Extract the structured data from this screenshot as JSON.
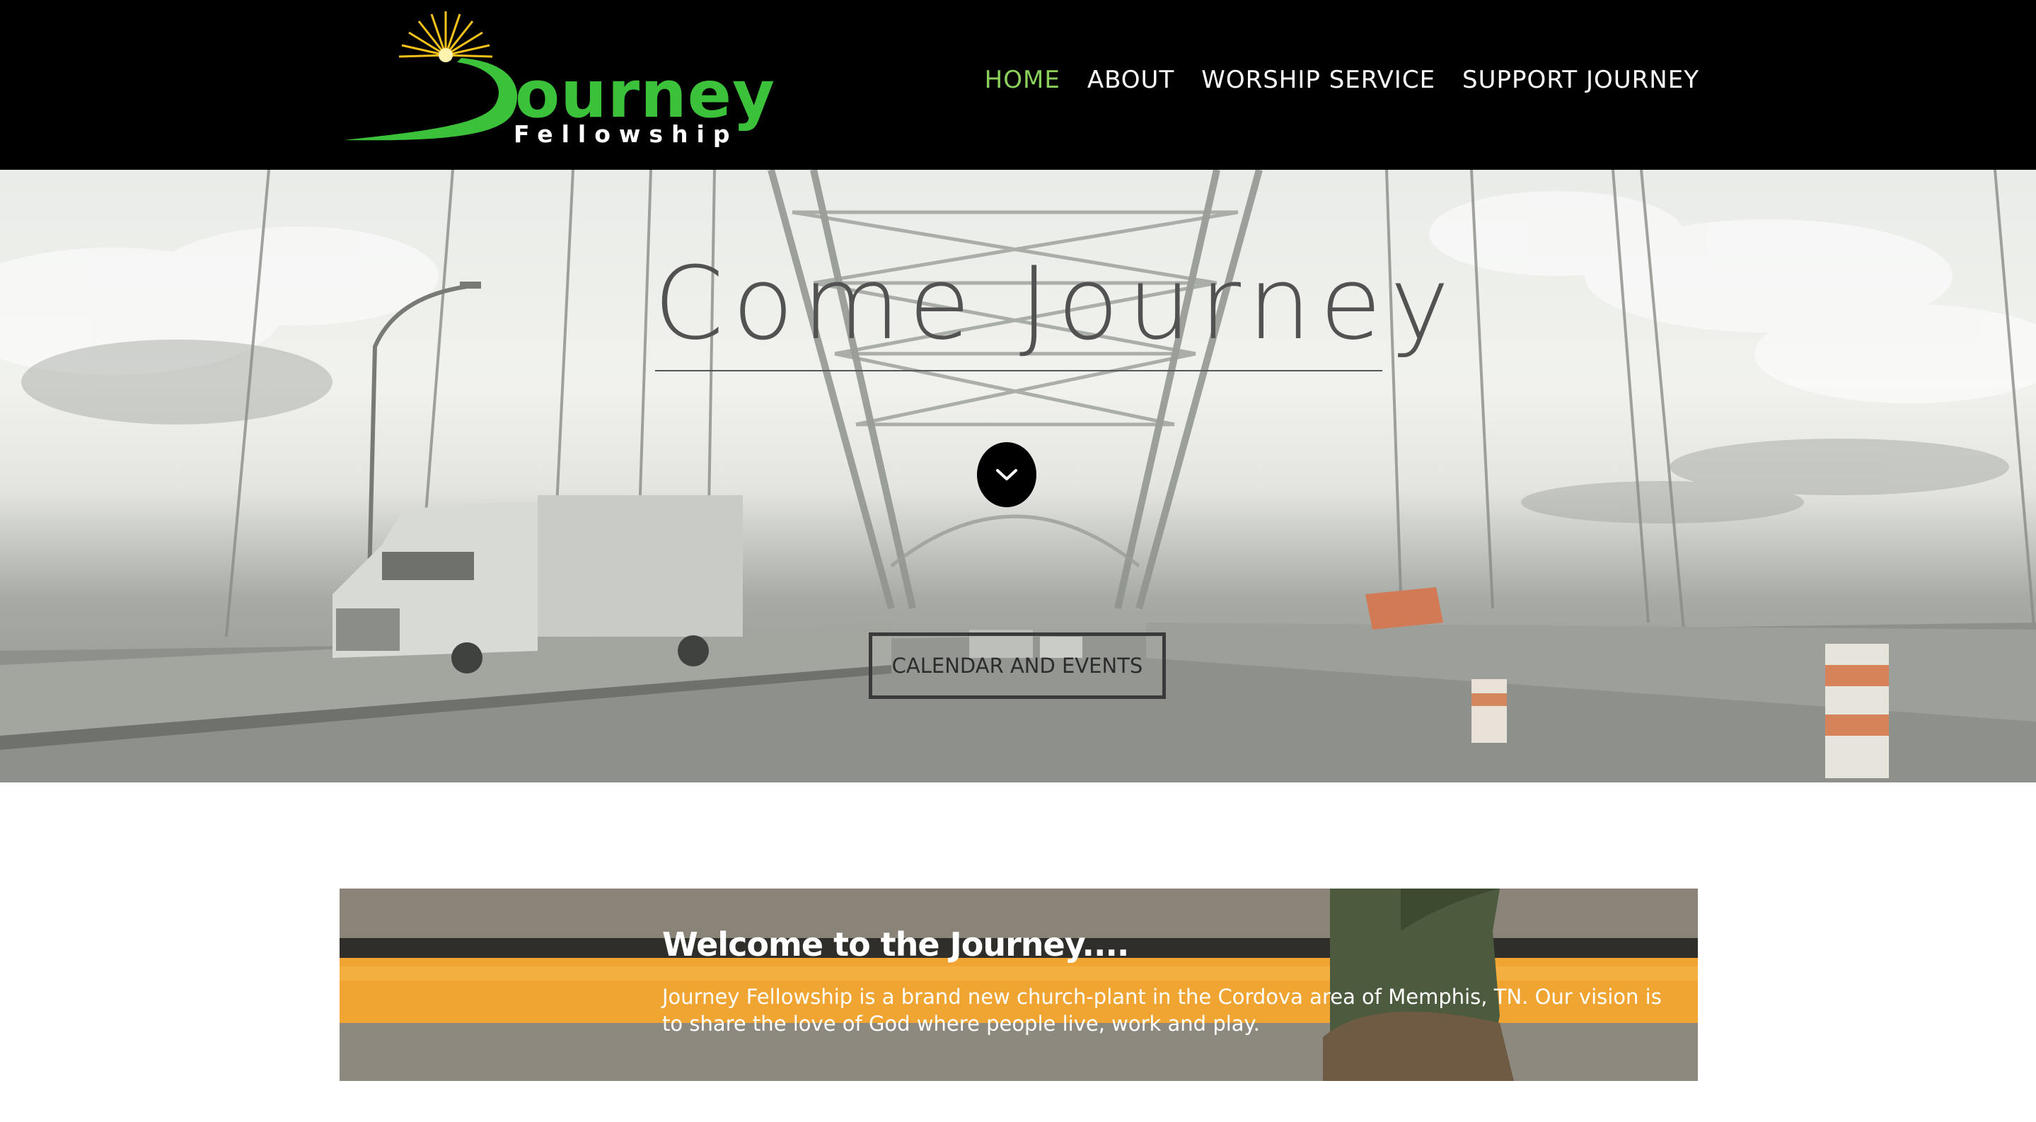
{
  "header": {
    "logo": {
      "word": "ourney",
      "sub": "Fellowship",
      "alt": "Journey Fellowship"
    },
    "nav": [
      {
        "label": "HOME",
        "active": true
      },
      {
        "label": "ABOUT",
        "active": false
      },
      {
        "label": "WORSHIP SERVICE",
        "active": false
      },
      {
        "label": "SUPPORT JOURNEY",
        "active": false
      }
    ]
  },
  "hero": {
    "title": "Come Journey",
    "scroll_icon": "chevron-down-icon",
    "cta_label": "CALENDAR AND EVENTS"
  },
  "welcome": {
    "title": "Welcome to the Journey....",
    "body": "Journey Fellowship is a brand new church-plant in the Cordova area of Memphis, TN. Our vision is to share the love of God where people live, work and play."
  },
  "colors": {
    "header_bg": "#000000",
    "nav_active": "#8bd05a",
    "logo_green": "#3cc13b",
    "banner_stripe": "#f0a533"
  }
}
